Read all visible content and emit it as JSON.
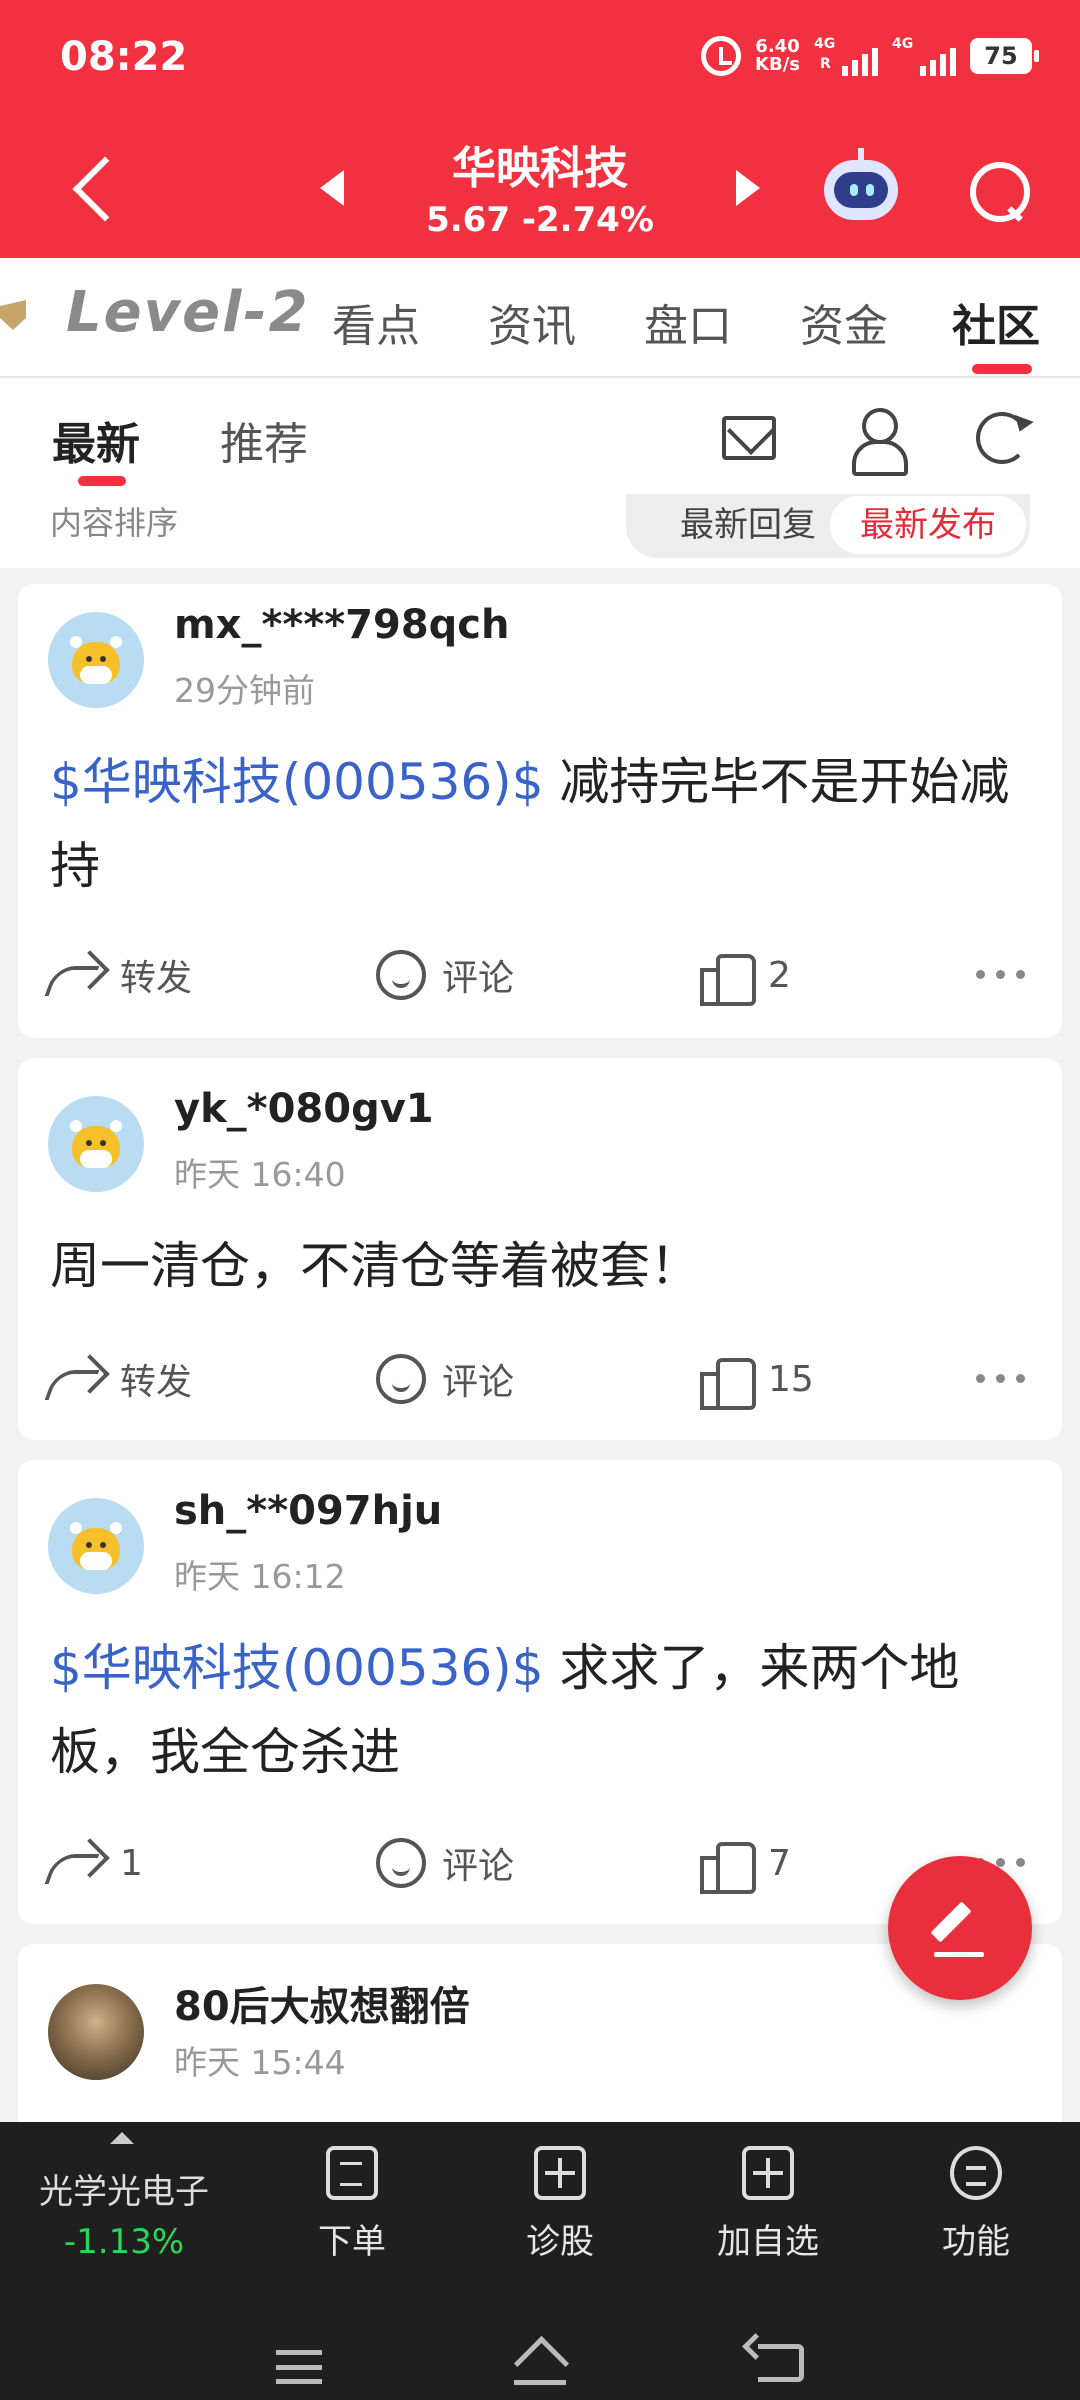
{
  "status_bar": {
    "time": "08:22",
    "net_speed_value": "6.40",
    "net_speed_unit": "KB/s",
    "sim1": "4G",
    "sim1_roaming": "R",
    "sim2": "4G",
    "battery": "75"
  },
  "header": {
    "stock_name": "华映科技",
    "price_line": "5.67  -2.74%"
  },
  "tabs": {
    "level2": "Level-2",
    "items": [
      "看点",
      "资讯",
      "盘口",
      "资金",
      "社区"
    ],
    "active_index": 4
  },
  "subtabs": {
    "latest": "最新",
    "recommend": "推荐"
  },
  "sort": {
    "label": "内容排序",
    "option_reply": "最新回复",
    "option_publish": "最新发布",
    "selected": "最新发布"
  },
  "posts": [
    {
      "user": "mx_****798qch",
      "time": "29分钟前",
      "tag": "$华映科技(000536)$",
      "text": " 减持完毕不是开始减持",
      "share": "转发",
      "comment": "评论",
      "likes": "2"
    },
    {
      "user": "yk_*080gv1",
      "time": "昨天 16:40",
      "tag": "",
      "text": "周一清仓，不清仓等着被套！",
      "share": "转发",
      "comment": "评论",
      "likes": "15"
    },
    {
      "user": "sh_**097hju",
      "time": "昨天 16:12",
      "tag": "$华映科技(000536)$",
      "text": " 求求了，来两个地板，我全仓杀进",
      "share": "1",
      "comment": "评论",
      "likes": "7"
    },
    {
      "user": "80后大叔想翻倍",
      "time": "昨天 15:44"
    }
  ],
  "bottom_bar": {
    "sector_name": "光学光电子",
    "sector_change": "-1.13%",
    "order": "下单",
    "diagnose": "诊股",
    "add_watchlist": "加自选",
    "functions": "功能"
  },
  "colors": {
    "brand_red": "#f23140",
    "link_blue": "#3a63c9",
    "down_green": "#2bd65a"
  }
}
